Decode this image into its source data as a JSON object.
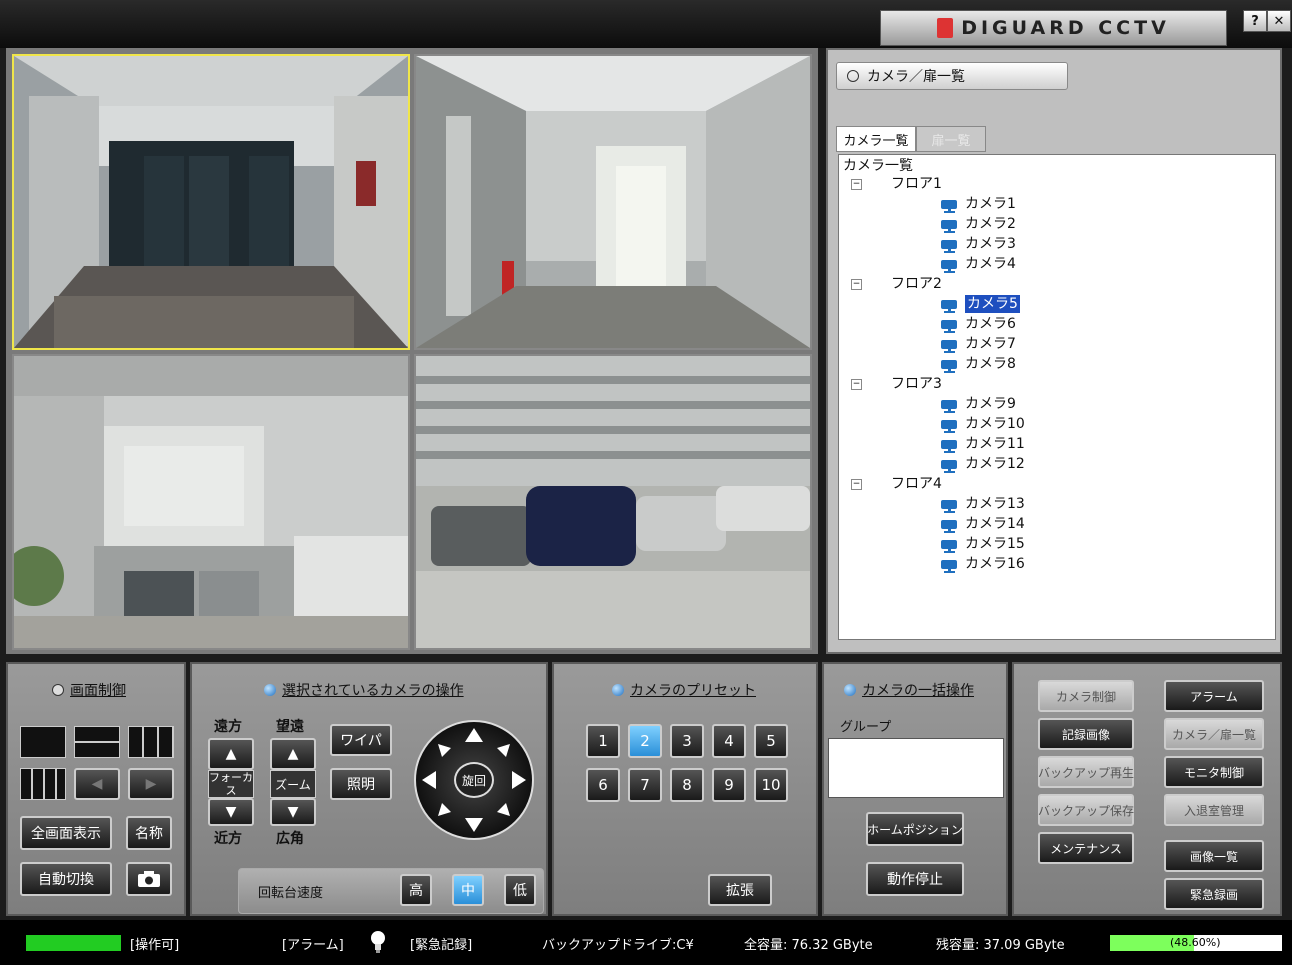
{
  "app": {
    "title": "DIGUARD CCTV",
    "help_label": "?",
    "close_label": "✕"
  },
  "cameras_view": {
    "feeds": [
      {
        "name": "cam-view-1",
        "selected": true
      },
      {
        "name": "cam-view-2",
        "selected": false
      },
      {
        "name": "cam-view-3",
        "selected": false
      },
      {
        "name": "cam-view-4",
        "selected": false
      }
    ]
  },
  "right_panel": {
    "header": "カメラ／扉一覧",
    "tabs": [
      {
        "label": "カメラ一覧",
        "active": true
      },
      {
        "label": "扉一覧",
        "active": false
      }
    ],
    "tree": {
      "root": "カメラ一覧",
      "floors": [
        {
          "label": "フロア1",
          "cameras": [
            "カメラ1",
            "カメラ2",
            "カメラ3",
            "カメラ4"
          ]
        },
        {
          "label": "フロア2",
          "cameras": [
            "カメラ5",
            "カメラ6",
            "カメラ7",
            "カメラ8"
          ]
        },
        {
          "label": "フロア3",
          "cameras": [
            "カメラ9",
            "カメラ10",
            "カメラ11",
            "カメラ12"
          ]
        },
        {
          "label": "フロア4",
          "cameras": [
            "カメラ13",
            "カメラ14",
            "カメラ15",
            "カメラ16"
          ]
        }
      ],
      "selected": "カメラ5",
      "expander": "−"
    }
  },
  "screen_control": {
    "title": "画面制御",
    "fullscreen": "全画面表示",
    "name": "名称",
    "auto_switch": "自動切換",
    "prev_icon": "◀",
    "next_icon": "▶"
  },
  "camera_ops": {
    "title": "選択されているカメラの操作",
    "far": "遠方",
    "tele": "望遠",
    "near": "近方",
    "wide": "広角",
    "focus_auto": "フォーカス AUTO",
    "zoom": "ズーム",
    "wiper": "ワイパ",
    "light": "照明",
    "rotate": "旋回",
    "up_arrow": "▲",
    "down_arrow": "▼",
    "speed_label": "回転台速度",
    "speeds": [
      "高",
      "中",
      "低"
    ],
    "speed_active": "中"
  },
  "presets": {
    "title": "カメラのプリセット",
    "buttons": [
      "1",
      "2",
      "3",
      "4",
      "5",
      "6",
      "7",
      "8",
      "9",
      "10"
    ],
    "active": "2",
    "expand": "拡張"
  },
  "batch_ops": {
    "title": "カメラの一括操作",
    "group_label": "グループ",
    "home_position": "ホームポジション",
    "stop": "動作停止"
  },
  "menu": {
    "left": [
      {
        "label": "カメラ制御",
        "enabled": false
      },
      {
        "label": "記録画像",
        "enabled": true
      },
      {
        "label": "バックアップ再生",
        "enabled": false
      },
      {
        "label": "バックアップ保存",
        "enabled": false
      },
      {
        "label": "メンテナンス",
        "enabled": true
      }
    ],
    "right": [
      {
        "label": "アラーム",
        "enabled": true
      },
      {
        "label": "カメラ／扉一覧",
        "enabled": false
      },
      {
        "label": "モニタ制御",
        "enabled": true
      },
      {
        "label": "入退室管理",
        "enabled": false
      },
      {
        "label": "画像一覧",
        "enabled": true
      },
      {
        "label": "緊急録画",
        "enabled": true
      }
    ]
  },
  "status": {
    "operable": "[操作可]",
    "alarm": "[アラーム]",
    "emergency": "[緊急記録]",
    "backup_drive": "バックアップドライブ:C¥",
    "total": "全容量: 76.32 GByte",
    "remaining": "残容量: 37.09 GByte",
    "usage_text": "(48.60%)",
    "usage_fraction": 0.486,
    "ok_color": "#22cc22"
  }
}
